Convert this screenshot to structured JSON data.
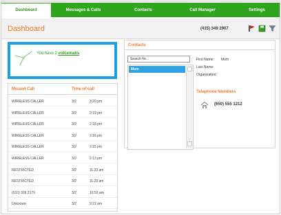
{
  "nav": {
    "tabs": [
      {
        "label": "Dashboard",
        "active": true
      },
      {
        "label": "Messages & Calls",
        "active": false
      },
      {
        "label": "Contacts",
        "active": false
      },
      {
        "label": "Call Manager",
        "active": false
      },
      {
        "label": "Settings",
        "active": false
      }
    ]
  },
  "header": {
    "title": "Dashboard",
    "phone": "(415) 349 2907",
    "icons": [
      "flag-icon",
      "save-icon",
      "filter-icon"
    ]
  },
  "voicemail": {
    "prefix": "You have 2",
    "link": "voicemails"
  },
  "missed_calls": {
    "col_caller": "Missed Call",
    "col_time": "Time of call",
    "rows": [
      {
        "caller": "WIRELESS CALLER",
        "date": "3/2",
        "time": "3:20 pm"
      },
      {
        "caller": "WIRELESS CALLER",
        "date": "3/2",
        "time": "3:19 pm"
      },
      {
        "caller": "WIRELESS CALLER",
        "date": "3/2",
        "time": "2:18 pm"
      },
      {
        "caller": "WIRELESS CALLER",
        "date": "3/2",
        "time": "2:16 pm"
      },
      {
        "caller": "WIRELESS CALLER",
        "date": "3/2",
        "time": "2:15 pm"
      },
      {
        "caller": "WIRELESS CALLER",
        "date": "3/2",
        "time": "2:13 pm"
      },
      {
        "caller": "RESTRICTED",
        "date": "3/2",
        "time": "11:33 am"
      },
      {
        "caller": "RESTRICTED",
        "date": "3/2",
        "time": "11:29 am"
      },
      {
        "caller": "(510) 309 2179",
        "date": "3/2",
        "time": "10:53 am"
      },
      {
        "caller": "Unknown",
        "date": "3/2",
        "time": "9:22 am"
      }
    ]
  },
  "contacts": {
    "title": "Contacts",
    "search_value": "Search for...",
    "selected_contact": "Mom",
    "first_name_label": "First Name:",
    "first_name_value": "Mom",
    "last_name_label": "Last Name:",
    "organization_label": "Organization:",
    "tel_title": "Telephone Numbers",
    "tel_value": "(650) 555 1212"
  },
  "colors": {
    "nav_green": "#2fa51e",
    "accent_orange": "#f07a2a",
    "selection_blue": "#2fa0e0"
  }
}
